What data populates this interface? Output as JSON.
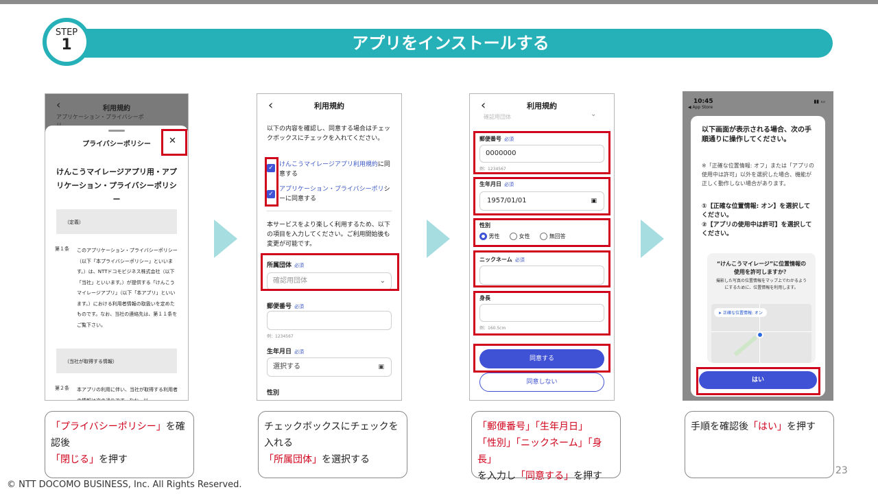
{
  "header": {
    "step_label": "STEP",
    "step_number": "1",
    "title": "アプリをインストールする"
  },
  "panel1": {
    "header_title": "利用規約",
    "header_sub": "アプリケーション・プライバシーポ",
    "header_sub2": "リ",
    "sheet_title": "プライバシーポリシー",
    "close_glyph": "✕",
    "doc_title": "けんこうマイレージアプリ用・アプリケーション・プライバシーポリシー",
    "section1_heading": "（定義）",
    "article1_no": "第１条",
    "article1_text": "このアプリケーション・プライバシーポリシー（以下「本プライバシーポリシー」といいます。）は、NTTドコモビジネス株式会社（以下「当社」といいます。）が提供する「けんこうマイレージアプリ」（以下「本アプリ」といいます。）における利用者情報の取扱いを定めたものです。なお、当社の連絡先は、第１１条をご覧下さい。",
    "section2_heading": "（当社が取得する情報）",
    "article2_no": "第２条",
    "article2_text": "本アプリの利用に伴い、当社が取得する利用者の情報は次の通りです。なお、以"
  },
  "panel2": {
    "header_title": "利用規約",
    "intro": "以下の内容を確認し、同意する場合はチェックボックスにチェックを入れてください。",
    "check1_link": "けんこうマイレージアプリ利用規約",
    "check1_suffix": "に同意する",
    "check2_link": "アプリケーション・プライバシーポリ",
    "check2_suffix": "シーに同意する",
    "note": "本サービスをより楽しく利用するため、以下の項目を入力してください。ご利用開始後も変更が可能です。",
    "org_label": "所属団体",
    "required": "必須",
    "org_placeholder": "確認用団体",
    "zip_label": "郵便番号",
    "zip_hint": "例：1234567",
    "birth_label": "生年月日",
    "birth_placeholder": "選択する",
    "gender_label": "性別"
  },
  "panel3": {
    "header_title": "利用規約",
    "top_field": "確認用団体",
    "zip_label": "郵便番号",
    "required": "必須",
    "zip_value": "0000000",
    "zip_hint": "例：1234567",
    "birth_label": "生年月日",
    "birth_value": "1957/01/01",
    "gender_label": "性別",
    "gender_options": [
      "男性",
      "女性",
      "無回答"
    ],
    "nickname_label": "ニックネーム",
    "height_label": "身長",
    "height_hint": "例：160.5cm",
    "agree_button": "同意する",
    "disagree_button": "同意しない"
  },
  "panel4": {
    "time": "10:45",
    "app_store": "◀ App Store",
    "instruction_title": "以下画面が表示される場合、次の手順通りに操作してください。",
    "instruction_note": "※「正確な位置情報: オフ」または「アプリの使用中は許可」以外を選択した場合、機能が正しく動作しない場合があります。",
    "step1": "①【正確な位置情報: オン】を選択してください。",
    "step2": "②【アプリの使用中は許可】を選択してください。",
    "dialog_title": "“けんこうマイレージ”に位置情報の使用を許可しますか？",
    "dialog_body": "撮影した写真の位置情報をマップ上でわかるようにするために、位置情報を利用します。",
    "precise_chip": "正確な位置情報: オン",
    "yes_button": "はい"
  },
  "captions": {
    "c1_red1": "「プライバシーポリシー」",
    "c1_text1": "を確認後",
    "c1_red2": "「閉じる」",
    "c1_text2": "を押す",
    "c2_text1": "チェックボックスにチェックを入れる",
    "c2_red1": "「所属団体」",
    "c2_text2": "を選択する",
    "c3_red1": "「郵便番号」「生年月日」",
    "c3_red2": "「性別」「ニックネーム」「身長」",
    "c3_text1": "を入力し",
    "c3_red3": "「同意する」",
    "c3_text2": "を押す",
    "c4_text1": "手順を確認後",
    "c4_red1": "「はい」",
    "c4_text2": "を押す"
  },
  "footer": {
    "copyright": "© NTT DOCOMO BUSINESS, Inc. All Rights Reserved.",
    "page_number": "23"
  },
  "colors": {
    "accent_teal": "#25b1b7",
    "arrow": "#a5dde0",
    "highlight_red": "#d0021b",
    "button_blue": "#3f51d4"
  }
}
